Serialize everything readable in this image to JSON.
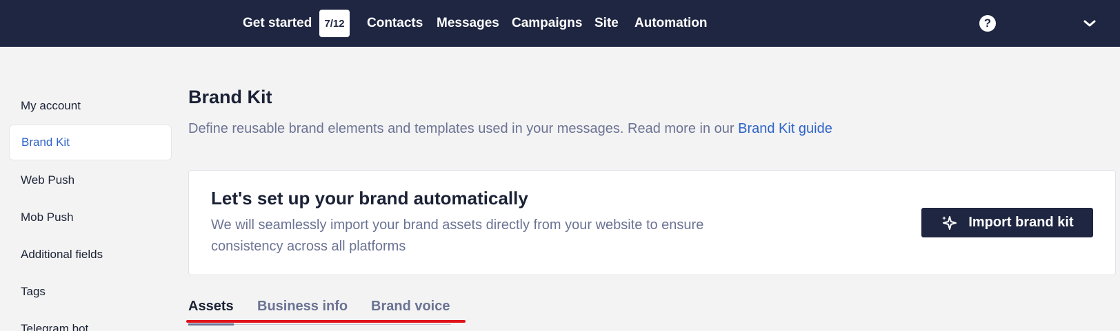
{
  "nav": {
    "get_started": "Get started",
    "progress_badge": "7/12",
    "items": [
      "Contacts",
      "Messages",
      "Campaigns",
      "Site",
      "Automation"
    ],
    "help_icon": "question-circle-icon",
    "menu_icon": "chevron-down-icon"
  },
  "sidebar": {
    "items": [
      {
        "label": "My account",
        "active": false
      },
      {
        "label": "Brand Kit",
        "active": true
      },
      {
        "label": "Web Push",
        "active": false
      },
      {
        "label": "Mob Push",
        "active": false
      },
      {
        "label": "Additional fields",
        "active": false
      },
      {
        "label": "Tags",
        "active": false
      },
      {
        "label": "Telegram bot",
        "active": false
      }
    ]
  },
  "main": {
    "title": "Brand Kit",
    "subtitle": "Define reusable brand elements and templates used in your messages. Read more in our ",
    "subtitle_link": "Brand Kit guide",
    "card": {
      "title": "Let's set up your brand automatically",
      "description": "We will seamlessly import your brand assets directly from your website to ensure consistency across all platforms",
      "button_label": "Import brand kit",
      "button_icon": "sparkle-icon"
    },
    "tabs": [
      {
        "label": "Assets",
        "active": true
      },
      {
        "label": "Business info",
        "active": false
      },
      {
        "label": "Brand voice",
        "active": false
      }
    ]
  },
  "colors": {
    "topbar": "#1f2642",
    "link": "#2d63c8",
    "muted_text": "#6b7394",
    "annotation_red": "#e0131a"
  }
}
